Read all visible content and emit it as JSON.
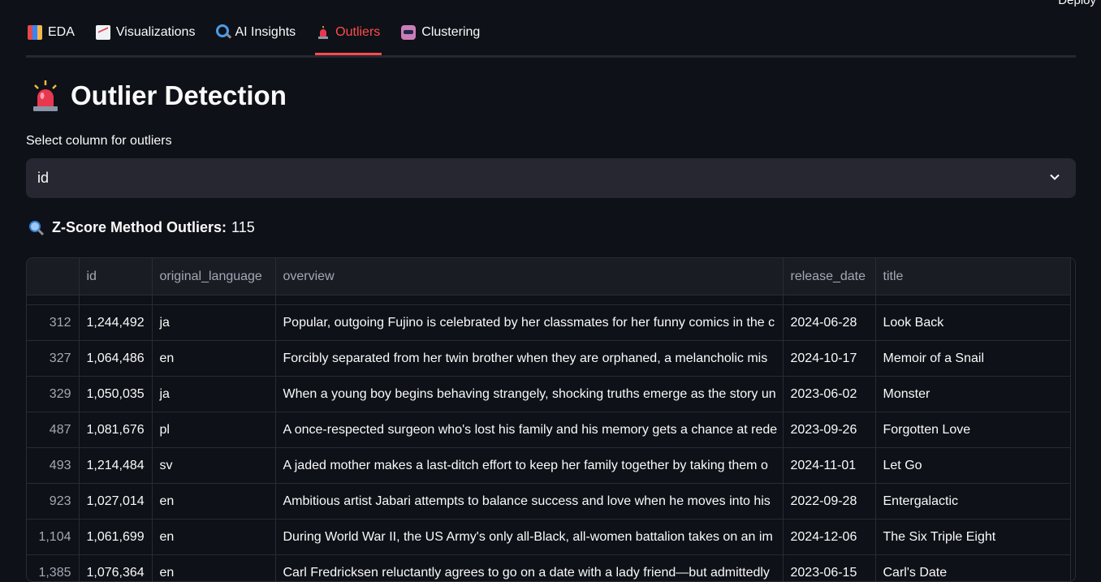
{
  "header": {
    "deploy_label": "Deploy"
  },
  "tabs": [
    {
      "label": "EDA",
      "icon": "bar-chart-icon",
      "active": false
    },
    {
      "label": "Visualizations",
      "icon": "line-chart-icon",
      "active": false
    },
    {
      "label": "AI Insights",
      "icon": "magnifier-icon",
      "active": false
    },
    {
      "label": "Outliers",
      "icon": "siren-icon",
      "active": true
    },
    {
      "label": "Clustering",
      "icon": "robot-icon",
      "active": false
    }
  ],
  "page": {
    "title": "Outlier Detection",
    "title_icon": "siren-icon"
  },
  "selector": {
    "label": "Select column for outliers",
    "value": "id"
  },
  "zscore": {
    "label": "Z-Score Method Outliers:",
    "count": "115"
  },
  "table": {
    "columns": [
      "",
      "id",
      "original_language",
      "overview",
      "release_date",
      "title"
    ],
    "rows": [
      [
        "312",
        "1,244,492",
        "ja",
        "Popular, outgoing Fujino is celebrated by her classmates for her funny comics in the c",
        "2024-06-28",
        "Look Back"
      ],
      [
        "327",
        "1,064,486",
        "en",
        "Forcibly separated from her twin brother when they are orphaned, a melancholic mis",
        "2024-10-17",
        "Memoir of a Snail"
      ],
      [
        "329",
        "1,050,035",
        "ja",
        "When a young boy begins behaving strangely, shocking truths emerge as the story un",
        "2023-06-02",
        "Monster"
      ],
      [
        "487",
        "1,081,676",
        "pl",
        "A once-respected surgeon who's lost his family and his memory gets a chance at rede",
        "2023-09-26",
        "Forgotten Love"
      ],
      [
        "493",
        "1,214,484",
        "sv",
        "A jaded mother makes a last-ditch effort to keep her family together by taking them o",
        "2024-11-01",
        "Let Go"
      ],
      [
        "923",
        "1,027,014",
        "en",
        "Ambitious artist Jabari attempts to balance success and love when he moves into his",
        "2022-09-28",
        "Entergalactic"
      ],
      [
        "1,104",
        "1,061,699",
        "en",
        "During World War II, the US Army's only all-Black, all-women battalion takes on an im",
        "2024-12-06",
        "The Six Triple Eight"
      ],
      [
        "1,385",
        "1,076,364",
        "en",
        "Carl Fredricksen reluctantly agrees to go on a date with a lady friend—but admittedly",
        "2023-06-15",
        "Carl's Date"
      ]
    ]
  },
  "colors": {
    "background": "#0e1117",
    "accent": "#ff4b4b",
    "input_bg": "#262730"
  }
}
